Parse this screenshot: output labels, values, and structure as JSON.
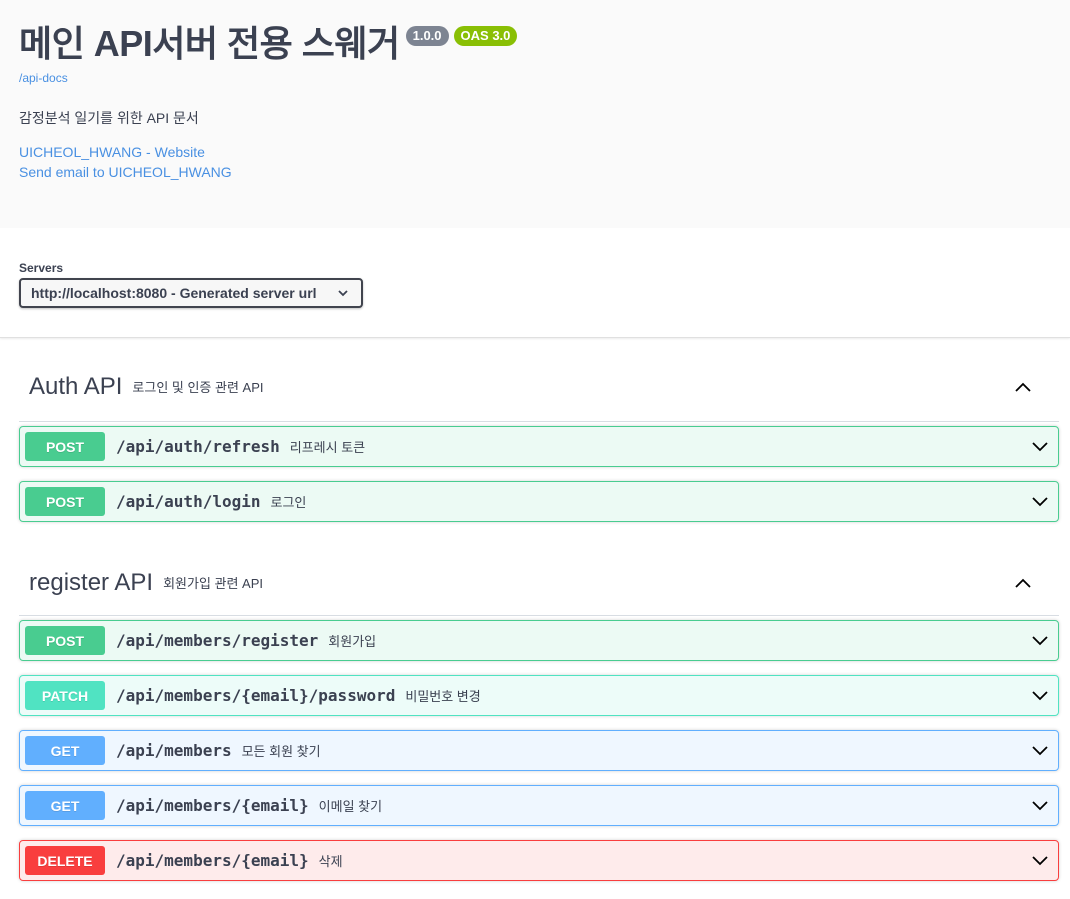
{
  "info": {
    "title": "메인 API서버 전용 스웨거",
    "version_badge": "1.0.0",
    "oas_badge": "OAS 3.0",
    "docs_link": "/api-docs",
    "description": "감정분석 일기를 위한 API 문서",
    "website_link": "UICHEOL_HWANG - Website",
    "email_link": "Send email to UICHEOL_HWANG"
  },
  "servers": {
    "label": "Servers",
    "selected": "http://localhost:8080 - Generated server url"
  },
  "tags": [
    {
      "name": "Auth API",
      "description": "로그인 및 인증 관련 API",
      "operations": [
        {
          "method": "POST",
          "path": "/api/auth/refresh",
          "summary": "리프레시 토큰"
        },
        {
          "method": "POST",
          "path": "/api/auth/login",
          "summary": "로그인"
        }
      ]
    },
    {
      "name": "register API",
      "description": "회원가입 관련 API",
      "operations": [
        {
          "method": "POST",
          "path": "/api/members/register",
          "summary": "회원가입"
        },
        {
          "method": "PATCH",
          "path": "/api/members/{email}/password",
          "summary": "비밀번호 변경"
        },
        {
          "method": "GET",
          "path": "/api/members",
          "summary": "모든 회원 찾기"
        },
        {
          "method": "GET",
          "path": "/api/members/{email}",
          "summary": "이메일 찾기"
        },
        {
          "method": "DELETE",
          "path": "/api/members/{email}",
          "summary": "삭제"
        }
      ]
    }
  ],
  "colors": {
    "post": "#49cc90",
    "patch": "#50e3c2",
    "get": "#61afe",
    "delete": "#f93e3e",
    "link": "#4990e2"
  }
}
